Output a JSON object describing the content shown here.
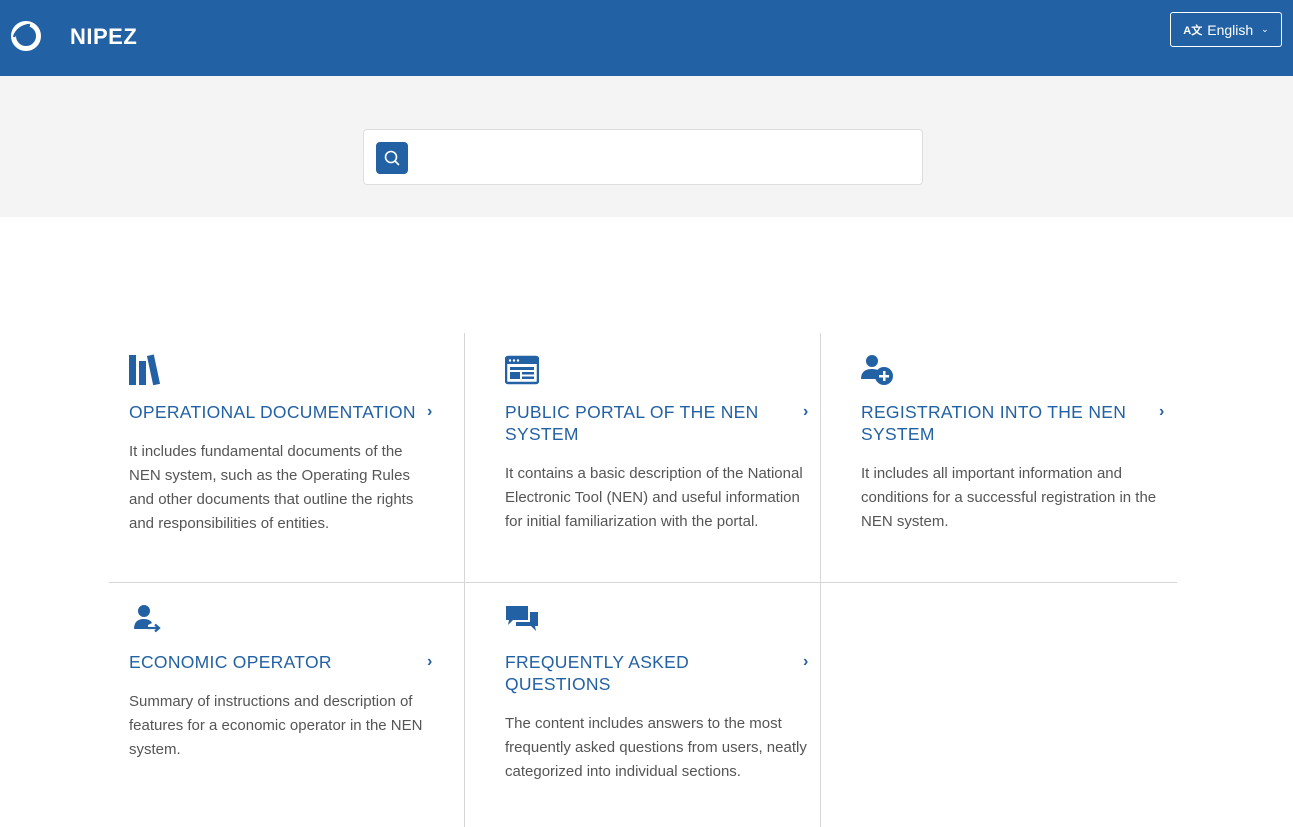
{
  "header": {
    "brand": "NIPEZ",
    "language": "English",
    "language_icon": "translate-icon",
    "colors": {
      "primary": "#2361a5"
    }
  },
  "search": {
    "placeholder": "",
    "icon": "search-icon"
  },
  "cards": [
    {
      "icon": "books-icon",
      "title": "OPERATIONAL DOCUMENTATION",
      "description": "It includes fundamental documents of the NEN system, such as the Operating Rules and other documents that outline the rights and responsibilities of entities."
    },
    {
      "icon": "browser-window-icon",
      "title": "PUBLIC PORTAL OF THE NEN SYSTEM",
      "description": "It contains a basic description of the National Electronic Tool (NEN) and useful information for initial familiarization with the portal."
    },
    {
      "icon": "user-add-icon",
      "title": "REGISTRATION INTO THE NEN SYSTEM",
      "description": "It includes all important information and conditions for a successful registration in the NEN system."
    },
    {
      "icon": "user-arrow-icon",
      "title": "ECONOMIC OPERATOR",
      "description": "Summary of instructions and description of features for a economic operator in the NEN system."
    },
    {
      "icon": "chat-bubbles-icon",
      "title": "FREQUENTLY ASKED QUESTIONS",
      "description": "The content includes answers to the most frequently asked questions from users, neatly categorized into individual sections."
    }
  ]
}
